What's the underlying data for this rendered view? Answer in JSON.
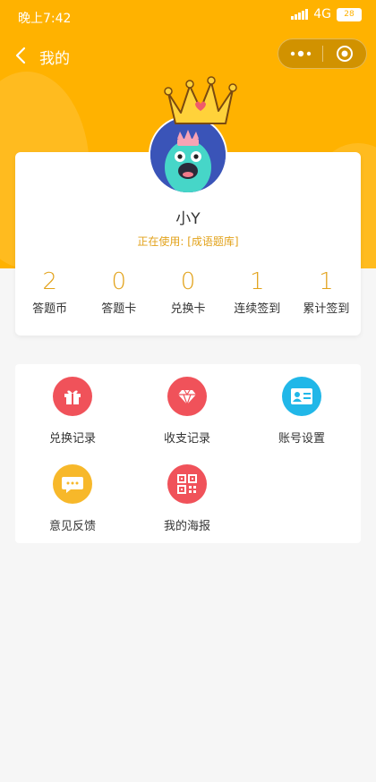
{
  "statusbar": {
    "time": "晚上7:42",
    "network": "4G",
    "battery": "28"
  },
  "navbar": {
    "title": "我的"
  },
  "profile": {
    "name": "小Y",
    "using_text": "正在使用: [成语题库]"
  },
  "stats": [
    {
      "value": "2",
      "label": "答题币"
    },
    {
      "value": "0",
      "label": "答题卡"
    },
    {
      "value": "0",
      "label": "兑换卡"
    },
    {
      "value": "1",
      "label": "连续签到"
    },
    {
      "value": "1",
      "label": "累计签到"
    }
  ],
  "menu": [
    {
      "label": "兑换记录",
      "icon": "gift-icon",
      "color": "#f0525a"
    },
    {
      "label": "收支记录",
      "icon": "diamond-icon",
      "color": "#f0525a"
    },
    {
      "label": "账号设置",
      "icon": "id-card-icon",
      "color": "#21b7e8"
    },
    {
      "label": "意见反馈",
      "icon": "chat-icon",
      "color": "#f7b82a"
    },
    {
      "label": "我的海报",
      "icon": "qr-code-icon",
      "color": "#f0525a"
    }
  ],
  "colors": {
    "header": "#ffb200",
    "accent": "#e2a21a"
  }
}
